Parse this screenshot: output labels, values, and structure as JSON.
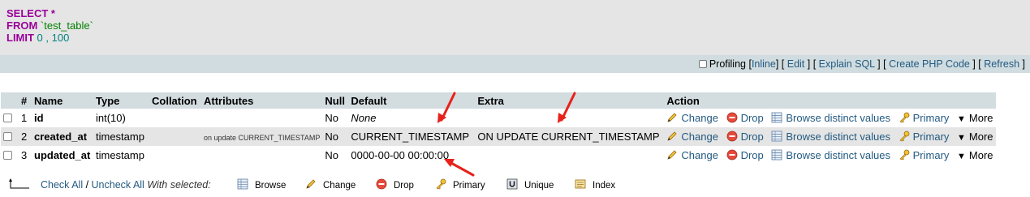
{
  "sql": {
    "line1_kw": "SELECT",
    "line1_rest": " *",
    "line2_kw": "FROM",
    "line2_table": " `test_table`",
    "line3_kw": "LIMIT",
    "line3_a": " 0",
    "line3_sep": " , ",
    "line3_b": "100"
  },
  "toolbar": {
    "profiling_label": "Profiling",
    "inline": "Inline",
    "edit": "Edit",
    "explain": "Explain SQL",
    "create_php": "Create PHP Code",
    "refresh": "Refresh"
  },
  "table": {
    "headers": [
      "#",
      "Name",
      "Type",
      "Collation",
      "Attributes",
      "Null",
      "Default",
      "Extra",
      "Action"
    ],
    "rows": [
      {
        "num": "1",
        "name": "id",
        "type": "int(10)",
        "collation": "",
        "attributes": "",
        "null": "No",
        "default": "None",
        "extra": ""
      },
      {
        "num": "2",
        "name": "created_at",
        "type": "timestamp",
        "collation": "",
        "attributes": "on update CURRENT_TIMESTAMP",
        "null": "No",
        "default": "CURRENT_TIMESTAMP",
        "extra": "ON UPDATE CURRENT_TIMESTAMP"
      },
      {
        "num": "3",
        "name": "updated_at",
        "type": "timestamp",
        "collation": "",
        "attributes": "",
        "null": "No",
        "default": "0000-00-00 00:00:00",
        "extra": ""
      }
    ],
    "actions": {
      "change": "Change",
      "drop": "Drop",
      "browse_distinct": "Browse distinct values",
      "primary": "Primary",
      "more": "More"
    }
  },
  "bottom": {
    "check_all": "Check All",
    "slash": " / ",
    "uncheck_all": "Uncheck All",
    "with_selected": "With selected:",
    "browse": "Browse",
    "change": "Change",
    "drop": "Drop",
    "primary": "Primary",
    "unique": "Unique",
    "index": "Index"
  },
  "colors": {
    "keyword": "#990099",
    "table_name": "#008000",
    "number": "#008080",
    "link": "#235a81",
    "arrow": "#e8211b",
    "header_bg": "#d3dcdf",
    "alt_row_bg": "#e5e5e5"
  }
}
